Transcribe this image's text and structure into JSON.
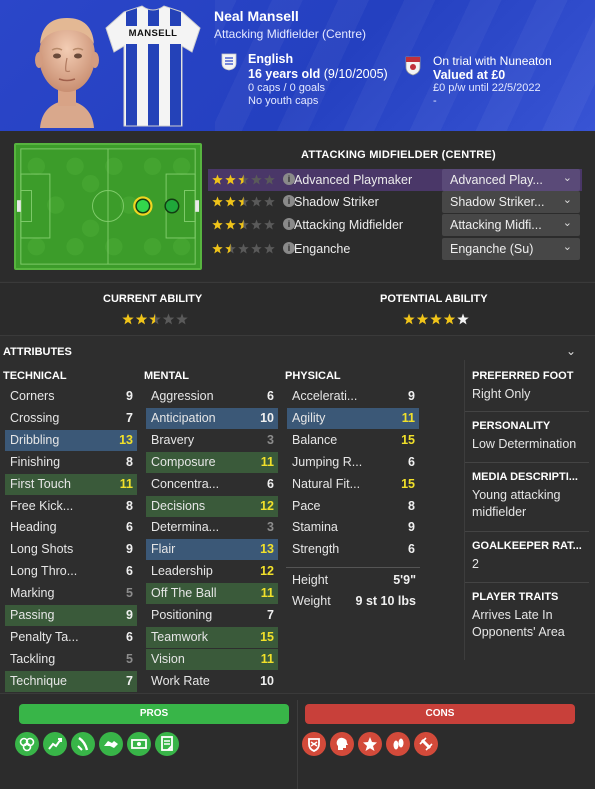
{
  "player": {
    "name": "Neal Mansell",
    "position": "Attacking Midfielder (Centre)",
    "nationality": "English",
    "age": "16 years old",
    "dob": "(9/10/2005)",
    "caps_goals": "0 caps / 0 goals",
    "youth_caps": "No youth caps",
    "club_status": "On trial with Nuneaton",
    "value": "Valued at £0",
    "contract": "£0 p/w until 22/5/2022",
    "contract_extra": "-",
    "shirt_name": "MANSELL"
  },
  "roles": {
    "title": "ATTACKING MIDFIELDER (CENTRE)",
    "items": [
      {
        "name": "Advanced Playmaker",
        "stars": 2.5,
        "duty": "Advanced Play...",
        "selected": true
      },
      {
        "name": "Shadow Striker",
        "stars": 2.5,
        "duty": "Shadow Striker...",
        "selected": false
      },
      {
        "name": "Attacking Midfielder",
        "stars": 2.5,
        "duty": "Attacking Midfi...",
        "selected": false
      },
      {
        "name": "Enganche",
        "stars": 1.5,
        "duty": "Enganche (Su)",
        "selected": false
      }
    ]
  },
  "ability": {
    "current_label": "CURRENT ABILITY",
    "current_stars": 2.5,
    "potential_label": "POTENTIAL ABILITY",
    "potential_stars": 4
  },
  "attributes": {
    "header": "ATTRIBUTES",
    "technical_title": "TECHNICAL",
    "mental_title": "MENTAL",
    "physical_title": "PHYSICAL",
    "technical": [
      {
        "name": "Corners",
        "value": "9",
        "hl": ""
      },
      {
        "name": "Crossing",
        "value": "7",
        "hl": ""
      },
      {
        "name": "Dribbling",
        "value": "13",
        "hl": "b"
      },
      {
        "name": "Finishing",
        "value": "8",
        "hl": ""
      },
      {
        "name": "First Touch",
        "value": "11",
        "hl": "g"
      },
      {
        "name": "Free Kick...",
        "value": "8",
        "hl": ""
      },
      {
        "name": "Heading",
        "value": "6",
        "hl": ""
      },
      {
        "name": "Long Shots",
        "value": "9",
        "hl": ""
      },
      {
        "name": "Long Thro...",
        "value": "6",
        "hl": ""
      },
      {
        "name": "Marking",
        "value": "5",
        "hl": ""
      },
      {
        "name": "Passing",
        "value": "9",
        "hl": "g"
      },
      {
        "name": "Penalty Ta...",
        "value": "6",
        "hl": ""
      },
      {
        "name": "Tackling",
        "value": "5",
        "hl": ""
      },
      {
        "name": "Technique",
        "value": "7",
        "hl": "g"
      }
    ],
    "mental": [
      {
        "name": "Aggression",
        "value": "6",
        "hl": ""
      },
      {
        "name": "Anticipation",
        "value": "10",
        "hl": "b"
      },
      {
        "name": "Bravery",
        "value": "3",
        "hl": ""
      },
      {
        "name": "Composure",
        "value": "11",
        "hl": "g"
      },
      {
        "name": "Concentra...",
        "value": "6",
        "hl": ""
      },
      {
        "name": "Decisions",
        "value": "12",
        "hl": "g"
      },
      {
        "name": "Determina...",
        "value": "3",
        "hl": ""
      },
      {
        "name": "Flair",
        "value": "13",
        "hl": "b"
      },
      {
        "name": "Leadership",
        "value": "12",
        "hl": ""
      },
      {
        "name": "Off The Ball",
        "value": "11",
        "hl": "g"
      },
      {
        "name": "Positioning",
        "value": "7",
        "hl": ""
      },
      {
        "name": "Teamwork",
        "value": "15",
        "hl": "g"
      },
      {
        "name": "Vision",
        "value": "11",
        "hl": "g"
      },
      {
        "name": "Work Rate",
        "value": "10",
        "hl": ""
      }
    ],
    "physical": [
      {
        "name": "Accelerati...",
        "value": "9",
        "hl": ""
      },
      {
        "name": "Agility",
        "value": "11",
        "hl": "b"
      },
      {
        "name": "Balance",
        "value": "15",
        "hl": ""
      },
      {
        "name": "Jumping R...",
        "value": "6",
        "hl": ""
      },
      {
        "name": "Natural Fit...",
        "value": "15",
        "hl": ""
      },
      {
        "name": "Pace",
        "value": "8",
        "hl": ""
      },
      {
        "name": "Stamina",
        "value": "9",
        "hl": ""
      },
      {
        "name": "Strength",
        "value": "6",
        "hl": ""
      }
    ],
    "height_label": "Height",
    "height": "5'9\"",
    "weight_label": "Weight",
    "weight": "9 st 10 lbs"
  },
  "info": {
    "foot_label": "PREFERRED FOOT",
    "foot": "Right Only",
    "personality_label": "PERSONALITY",
    "personality": "Low Determination",
    "media_label": "MEDIA DESCRIPTI...",
    "media": "Young attacking midfielder",
    "gk_label": "GOALKEEPER RAT...",
    "gk": "2",
    "traits_label": "PLAYER TRAITS",
    "traits": "Arrives Late In Opponents' Area"
  },
  "pros_cons": {
    "pros_label": "PROS",
    "cons_label": "CONS",
    "pros_icons": [
      "teamwork-icon",
      "improvement-icon",
      "dribble-icon",
      "handshake-icon",
      "money-icon",
      "contract-icon"
    ],
    "cons_icons": [
      "badge-icon",
      "mentality-icon",
      "star-icon",
      "feet-icon",
      "injury-icon"
    ]
  },
  "colors": {
    "header_bg": "#2b46c9",
    "pros": "#38b548",
    "cons": "#d34a3a",
    "highlight_green": "#3a5a3a",
    "highlight_blue": "#3b5877",
    "value_yellow": "#f1e02a",
    "role_selected": "#4a3768"
  }
}
